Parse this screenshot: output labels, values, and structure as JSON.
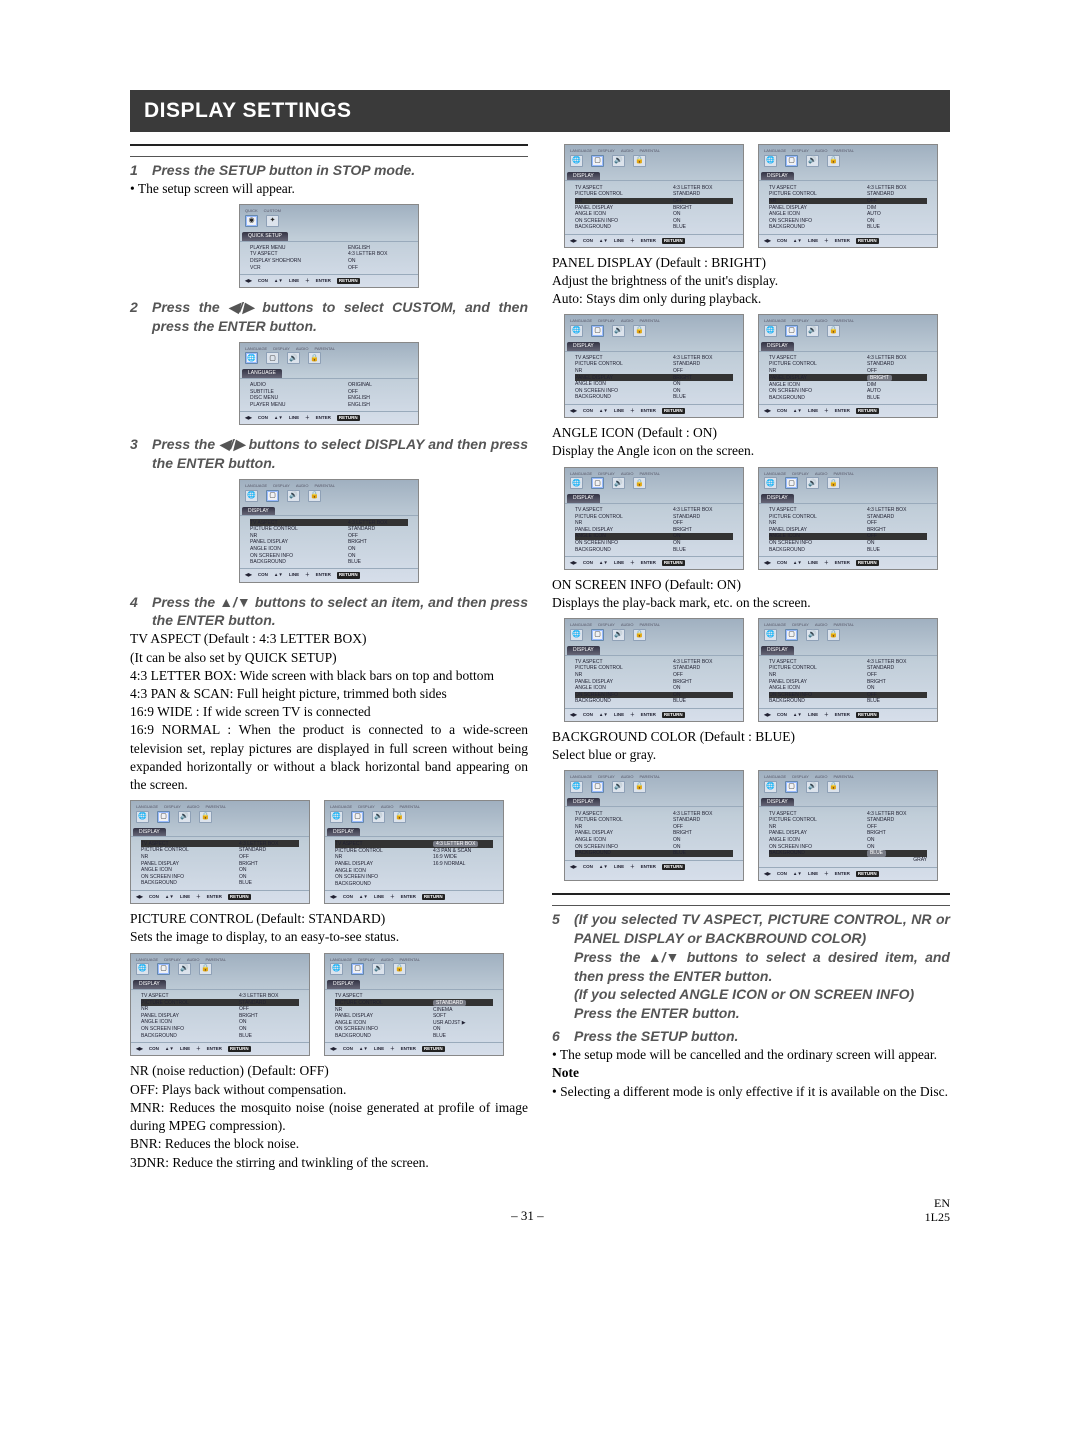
{
  "header": {
    "title": "DISPLAY SETTINGS"
  },
  "page_footer": {
    "page": "– 31 –",
    "lang": "EN",
    "code": "1L25"
  },
  "left": {
    "step1": {
      "num": "1",
      "text": "Press the SETUP button in STOP mode."
    },
    "appear": "The setup screen will appear.",
    "step2": {
      "num": "2",
      "text_a": "Press the ",
      "text_b": " buttons to select CUSTOM, and then press the ENTER button."
    },
    "step3": {
      "num": "3",
      "text_a": "Press the ",
      "text_b": " buttons to select DISPLAY and then press the ENTER button."
    },
    "step4": {
      "num": "4",
      "text_a": "Press the ",
      "text_b": " buttons to select an item, and then press the ENTER button."
    },
    "tva_head": "TV ASPECT (Default : 4:3 LETTER BOX)",
    "tva_sub": "(It can be also set by QUICK SETUP)",
    "tva_43lb": "4:3 LETTER BOX: Wide screen with black bars on top and bottom",
    "tva_43ps": "4:3 PAN & SCAN: Full height picture, trimmed both sides",
    "tva_169w": "16:9 WIDE : If wide screen TV is connected",
    "tva_169n": "16:9 NORMAL : When the product is connected to a wide-screen television set, replay pictures are displayed in full screen without being expanded horizontally or without a black horizontal band appearing on the screen.",
    "pc_head": "PICTURE CONTROL (Default: STANDARD)",
    "pc_sub": "Sets the image to display, to an easy-to-see status.",
    "nr_head": "NR (noise reduction) (Default: OFF)",
    "nr_off": "OFF: Plays back without compensation.",
    "nr_mnr": "MNR: Reduces the mosquito noise (noise generated at profile of image during MPEG compression).",
    "nr_bnr": "BNR: Reduces the block noise.",
    "nr_3dnr": "3DNR: Reduce the stirring and twinkling of the screen."
  },
  "right": {
    "panel_head": "PANEL DISPLAY (Default : BRIGHT)",
    "panel_l1": "Adjust the brightness of the unit's display.",
    "panel_l2": "Auto: Stays dim only during playback.",
    "angle_head": "ANGLE ICON (Default : ON)",
    "angle_l1": "Display the Angle icon on the screen.",
    "osd_head": "ON SCREEN INFO (Default: ON)",
    "osd_l1": "Displays the play-back mark, etc. on the screen.",
    "bg_head": "BACKGROUND COLOR (Default : BLUE)",
    "bg_l1": "Select blue or gray.",
    "step5": {
      "num": "5",
      "l1": "(If you selected TV ASPECT, PICTURE CONTROL, NR or PANEL DISPLAY or BACKBROUND COLOR)",
      "l2a": "Press the ",
      "l2b": " buttons to select a desired item, and then press the ENTER button.",
      "l3": "(If you selected ANGLE ICON or ON SCREEN INFO)",
      "l4": "Press the ENTER button."
    },
    "step6": {
      "num": "6",
      "text": "Press the SETUP button."
    },
    "cancel": "The setup mode will be cancelled and the ordinary screen will appear.",
    "note_label": "Note",
    "note_body": "Selecting a different mode is only effective if it is available on the Disc."
  },
  "osd": {
    "tabs": {
      "lang": "LANGUAGE",
      "disp": "DISPLAY",
      "audio": "AUDIO",
      "parental": "PARENTAL"
    },
    "quick": {
      "tab": "QUICK",
      "custom": "CUSTOM"
    },
    "quick_setup_tab": "QUICK SETUP",
    "lang_tab": "LANGUAGE",
    "display_tab": "DISPLAY",
    "foot": {
      "con": "CON",
      "line": "LINE",
      "enter": "ENTER",
      "return": "RETURN"
    },
    "foot_arrows": "◀▶",
    "foot_updown": "▲▼",
    "plus": "＋",
    "items": {
      "player_menu": {
        "k": "PLAYER MENU",
        "v": "ENGLISH"
      },
      "tv_aspect": {
        "k": "TV ASPECT",
        "v": "4:3 LETTER BOX"
      },
      "display_shoehorn": {
        "k": "DISPLAY SHOEHORN",
        "v": "ON"
      },
      "vcr": {
        "k": "VCR",
        "v": "OFF"
      },
      "audio": {
        "k": "AUDIO",
        "v": "ORIGINAL"
      },
      "subtitle": {
        "k": "SUBTITLE",
        "v": "OFF"
      },
      "disc_menu": {
        "k": "DISC MENU",
        "v": "ENGLISH"
      },
      "player_menu2": {
        "k": "PLAYER MENU",
        "v": "ENGLISH"
      },
      "picture_control": {
        "k": "PICTURE CONTROL",
        "v": "STANDARD"
      },
      "nr": {
        "k": "NR",
        "v": "OFF"
      },
      "panel_display": {
        "k": "PANEL DISPLAY",
        "v": "BRIGHT"
      },
      "angle_icon": {
        "k": "ANGLE ICON",
        "v": "ON"
      },
      "on_screen_info": {
        "k": "ON SCREEN INFO",
        "v": "ON"
      },
      "background": {
        "k": "BACKGROUND",
        "v": "BLUE"
      }
    },
    "values": {
      "standard": "STANDARD",
      "cinema": "CINEMA",
      "soft": "SOFT",
      "usr_adjust": "USR ADJST",
      "bright": "BRIGHT",
      "dim": "DIM",
      "auto": "AUTO",
      "on": "ON",
      "off": "OFF",
      "blue": "BLUE",
      "gray": "GRAY",
      "tva_43lb": "4:3 LETTER BOX",
      "tva_43ps": "4:3 PAN & SCAN",
      "tva_169w": "16:9 WIDE",
      "tva_169n": "16:9 NORMAL"
    }
  }
}
